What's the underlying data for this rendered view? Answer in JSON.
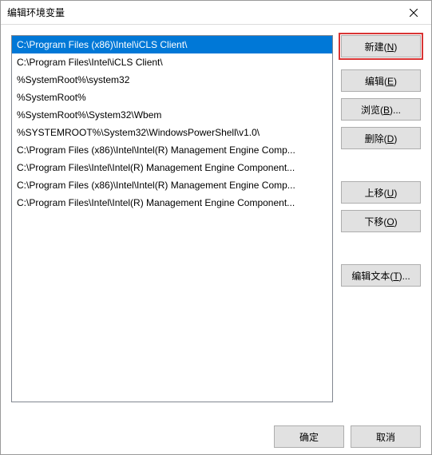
{
  "window": {
    "title": "编辑环境变量"
  },
  "list": {
    "items": [
      "C:\\Program Files (x86)\\Intel\\iCLS Client\\",
      "C:\\Program Files\\Intel\\iCLS Client\\",
      "%SystemRoot%\\system32",
      "%SystemRoot%",
      "%SystemRoot%\\System32\\Wbem",
      "%SYSTEMROOT%\\System32\\WindowsPowerShell\\v1.0\\",
      "C:\\Program Files (x86)\\Intel\\Intel(R) Management Engine Comp...",
      "C:\\Program Files\\Intel\\Intel(R) Management Engine Component...",
      "C:\\Program Files (x86)\\Intel\\Intel(R) Management Engine Comp...",
      "C:\\Program Files\\Intel\\Intel(R) Management Engine Component..."
    ],
    "selected_index": 0
  },
  "buttons": {
    "new": {
      "label": "新建",
      "mn": "N"
    },
    "edit": {
      "label": "编辑",
      "mn": "E"
    },
    "browse": {
      "label": "浏览",
      "mn": "B",
      "suffix": "..."
    },
    "delete": {
      "label": "删除",
      "mn": "D"
    },
    "move_up": {
      "label": "上移",
      "mn": "U"
    },
    "move_down": {
      "label": "下移",
      "mn": "O"
    },
    "edit_text": {
      "label": "编辑文本",
      "mn": "T",
      "suffix": "..."
    },
    "ok": "确定",
    "cancel": "取消"
  }
}
